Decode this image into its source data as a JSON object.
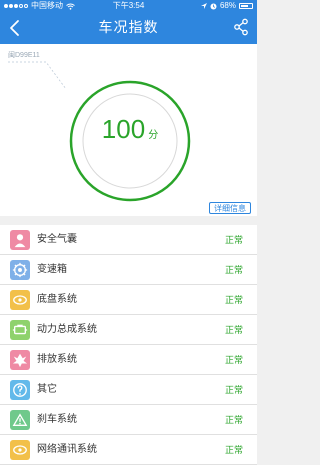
{
  "status_bar": {
    "carrier": "中国移动",
    "time": "下午3:54",
    "battery": "68%",
    "battery_level": 0.68
  },
  "header": {
    "title": "车况指数"
  },
  "hero": {
    "plate": "闽D99E11",
    "score": "100",
    "score_unit": "分",
    "detail_button": "详细信息"
  },
  "systems": [
    {
      "label": "安全气囊",
      "status": "正常",
      "icon": "airbag-icon",
      "color": "#ef8aa4"
    },
    {
      "label": "变速箱",
      "status": "正常",
      "icon": "gearbox-icon",
      "color": "#7fb0e8"
    },
    {
      "label": "底盘系统",
      "status": "正常",
      "icon": "chassis-icon",
      "color": "#f2c04a"
    },
    {
      "label": "动力总成系统",
      "status": "正常",
      "icon": "powertrain-icon",
      "color": "#8fd26d"
    },
    {
      "label": "排放系统",
      "status": "正常",
      "icon": "emission-icon",
      "color": "#ef8aa4"
    },
    {
      "label": "其它",
      "status": "正常",
      "icon": "other-icon",
      "color": "#62b9ea"
    },
    {
      "label": "刹车系统",
      "status": "正常",
      "icon": "brake-icon",
      "color": "#6fc98b"
    },
    {
      "label": "网络通讯系统",
      "status": "正常",
      "icon": "network-icon",
      "color": "#f2c04a"
    }
  ]
}
